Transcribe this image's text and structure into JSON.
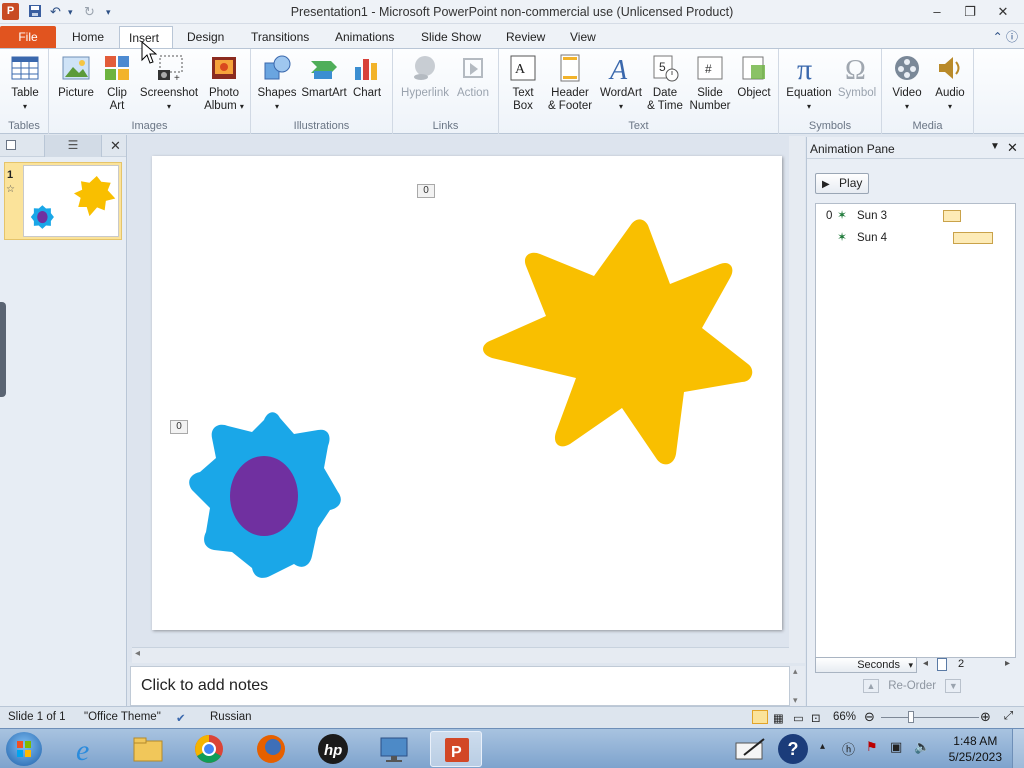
{
  "window": {
    "title": "Presentation1  -  Microsoft PowerPoint non-commercial use (Unlicensed Product)",
    "app_icon": "P"
  },
  "tabs": [
    {
      "label": "File"
    },
    {
      "label": "Home"
    },
    {
      "label": "Insert"
    },
    {
      "label": "Design"
    },
    {
      "label": "Transitions"
    },
    {
      "label": "Animations"
    },
    {
      "label": "Slide Show"
    },
    {
      "label": "Review"
    },
    {
      "label": "View"
    }
  ],
  "ribbon": {
    "groups": {
      "tables": "Tables",
      "images": "Images",
      "illustrations": "Illustrations",
      "links": "Links",
      "text": "Text",
      "symbols": "Symbols",
      "media": "Media"
    },
    "buttons": {
      "table": "Table",
      "picture": "Picture",
      "clip_art_1": "Clip",
      "clip_art_2": "Art",
      "screenshot": "Screenshot",
      "photo_album_1": "Photo",
      "photo_album_2": "Album",
      "shapes": "Shapes",
      "smartart": "SmartArt",
      "chart": "Chart",
      "hyperlink": "Hyperlink",
      "action": "Action",
      "text_box_1": "Text",
      "text_box_2": "Box",
      "header_footer_1": "Header",
      "header_footer_2": "& Footer",
      "wordart": "WordArt",
      "date_time_1": "Date",
      "date_time_2": "& Time",
      "slide_number_1": "Slide",
      "slide_number_2": "Number",
      "object": "Object",
      "equation": "Equation",
      "symbol": "Symbol",
      "video": "Video",
      "audio": "Audio"
    }
  },
  "slides_panel": {
    "slide_number": "1",
    "star": "☆"
  },
  "slide": {
    "tag_top": "0",
    "tag_left": "0",
    "colors": {
      "star": "#f9bf00",
      "flower": "#1aa7e8",
      "center": "#7030a0"
    }
  },
  "notes": {
    "placeholder": "Click to add notes"
  },
  "animation_pane": {
    "title": "Animation Pane",
    "play_label": "Play",
    "items": [
      {
        "index": "0",
        "name": "Sun 3"
      },
      {
        "index": "",
        "name": "Sun 4"
      }
    ],
    "seconds_label": "Seconds",
    "timeline_value": "2",
    "reorder_label": "Re-Order"
  },
  "status": {
    "slide_info": "Slide 1 of 1",
    "theme": "\"Office Theme\"",
    "language": "Russian",
    "zoom": "66%"
  },
  "taskbar": {
    "time": "1:48 AM",
    "date": "5/25/2023"
  }
}
